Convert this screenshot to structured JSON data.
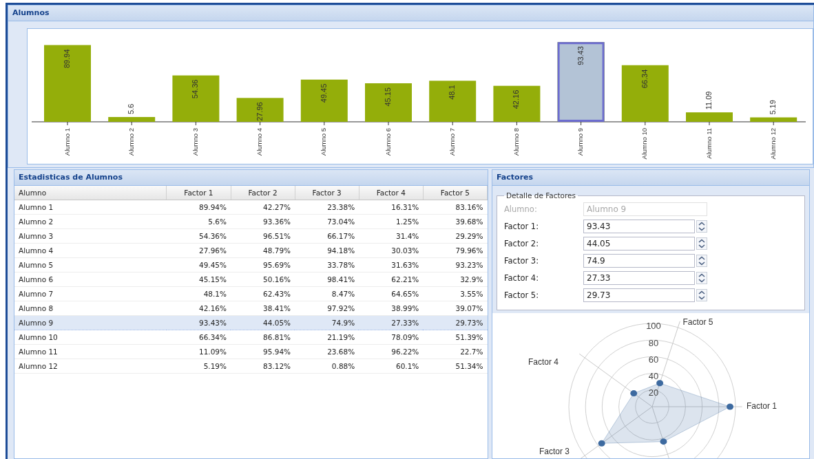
{
  "alumnos_panel": {
    "title": "Alumnos",
    "chart_data": {
      "type": "bar",
      "categories": [
        "Alumno 1",
        "Alumno 2",
        "Alumno 3",
        "Alumno 4",
        "Alumno 5",
        "Alumno 6",
        "Alumno 7",
        "Alumno 8",
        "Alumno 9",
        "Alumno 10",
        "Alumno 11",
        "Alumno 12"
      ],
      "series": [
        {
          "color": "#94ae0a",
          "values": [
            89.94,
            5.6,
            54.36,
            27.96,
            49.45,
            45.15,
            48.1,
            42.16,
            93.43,
            66.34,
            11.09,
            5.19
          ]
        }
      ],
      "data_labels": true
    }
  },
  "stats": {
    "title": "Estadisticas de Alumnos",
    "columns": [
      "Alumno",
      "Factor 1",
      "Factor 2",
      "Factor 3",
      "Factor 4",
      "Factor 5"
    ],
    "rows": [
      {
        "cells": [
          "Alumno 1",
          "89.94%",
          "42.27%",
          "23.38%",
          "16.31%",
          "83.16%"
        ],
        "selected": false
      },
      {
        "cells": [
          "Alumno 2",
          "5.6%",
          "93.36%",
          "73.04%",
          "1.25%",
          "39.68%"
        ],
        "selected": false
      },
      {
        "cells": [
          "Alumno 3",
          "54.36%",
          "96.51%",
          "66.17%",
          "31.4%",
          "29.29%"
        ],
        "selected": false
      },
      {
        "cells": [
          "Alumno 4",
          "27.96%",
          "48.79%",
          "94.18%",
          "30.03%",
          "79.96%"
        ],
        "selected": false
      },
      {
        "cells": [
          "Alumno 5",
          "49.45%",
          "95.69%",
          "33.78%",
          "31.63%",
          "93.23%"
        ],
        "selected": false
      },
      {
        "cells": [
          "Alumno 6",
          "45.15%",
          "50.16%",
          "98.41%",
          "62.21%",
          "32.9%"
        ],
        "selected": false
      },
      {
        "cells": [
          "Alumno 7",
          "48.1%",
          "62.43%",
          "8.47%",
          "64.65%",
          "3.55%"
        ],
        "selected": false
      },
      {
        "cells": [
          "Alumno 8",
          "42.16%",
          "38.41%",
          "97.92%",
          "38.99%",
          "39.07%"
        ],
        "selected": false
      },
      {
        "cells": [
          "Alumno 9",
          "93.43%",
          "44.05%",
          "74.9%",
          "27.33%",
          "29.73%"
        ],
        "selected": true
      },
      {
        "cells": [
          "Alumno 10",
          "66.34%",
          "86.81%",
          "21.19%",
          "78.09%",
          "51.39%"
        ],
        "selected": false
      },
      {
        "cells": [
          "Alumno 11",
          "11.09%",
          "95.94%",
          "23.68%",
          "96.22%",
          "22.7%"
        ],
        "selected": false
      },
      {
        "cells": [
          "Alumno 12",
          "5.19%",
          "83.12%",
          "0.88%",
          "60.1%",
          "51.34%"
        ],
        "selected": false
      }
    ]
  },
  "factores": {
    "title": "Factores",
    "fieldset": {
      "legend": "Detalle de Factores",
      "fields": [
        {
          "kind": "text",
          "label": "Alumno:",
          "value": "Alumno 9",
          "disabled": true
        },
        {
          "kind": "spinner",
          "label": "Factor 1:",
          "value": "93.43",
          "disabled": false,
          "radar_label": "Factor 1"
        },
        {
          "kind": "spinner",
          "label": "Factor 2:",
          "value": "44.05",
          "disabled": false
        },
        {
          "kind": "spinner",
          "label": "Factor 3:",
          "value": "74.9",
          "disabled": false,
          "radar_label": "Factor 3"
        },
        {
          "kind": "spinner",
          "label": "Factor 4:",
          "value": "27.33",
          "disabled": false,
          "radar_label": "Factor 4"
        },
        {
          "kind": "spinner",
          "label": "Factor 5:",
          "value": "29.73",
          "disabled": false,
          "radar_label": "Factor 5"
        }
      ]
    },
    "radar": {
      "ring_labels": [
        "100",
        "80",
        "60",
        "40",
        "20"
      ],
      "color": "#3d6aa0"
    }
  }
}
